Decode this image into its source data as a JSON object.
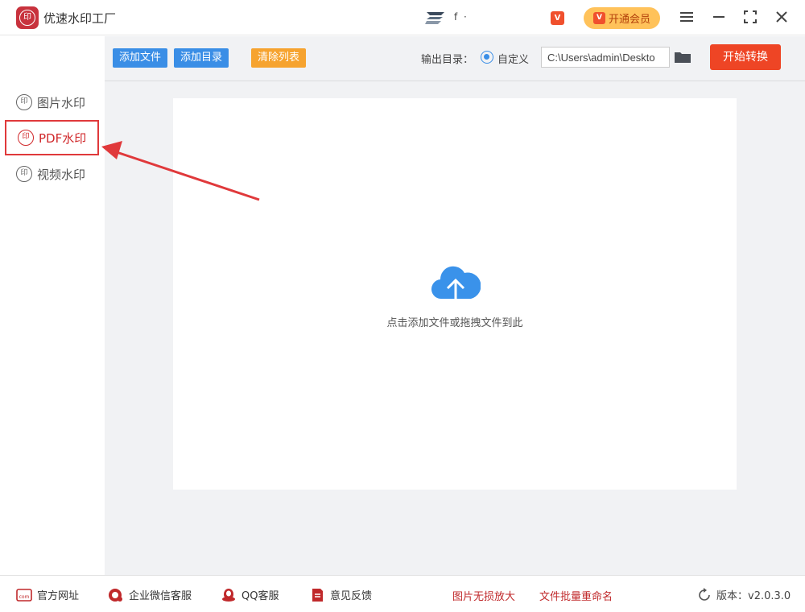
{
  "app": {
    "title": "优速水印工厂",
    "logo_text": "印"
  },
  "header": {
    "user_name": "f  ·",
    "vip_mini": "V",
    "vip_label": "开通会员",
    "vip_icon": "V"
  },
  "sidebar": {
    "items": [
      {
        "label": "图片水印",
        "icon": "印",
        "active": false
      },
      {
        "label": "PDF水印",
        "icon": "印",
        "active": true
      },
      {
        "label": "视频水印",
        "icon": "印",
        "active": false
      }
    ]
  },
  "toolbar": {
    "add_file": "添加文件",
    "add_dir": "添加目录",
    "clear_list": "清除列表",
    "output_label": "输出目录：",
    "radio_label": "自定义",
    "output_path": "C:\\Users\\admin\\Deskto",
    "start": "开始转换"
  },
  "dropzone": {
    "text": "点击添加文件或拖拽文件到此"
  },
  "footer": {
    "website": "官方网址",
    "wechat": "企业微信客服",
    "qq": "QQ客服",
    "feedback": "意见反馈",
    "enlarge": "图片无损放大",
    "rename": "文件批量重命名",
    "version": "版本：v2.0.3.0",
    "website_icon_text": "com"
  },
  "colors": {
    "accent_blue": "#3a8ee6",
    "accent_orange": "#f6a32f",
    "start_red": "#ee4525",
    "highlight_red": "#e0393b"
  }
}
